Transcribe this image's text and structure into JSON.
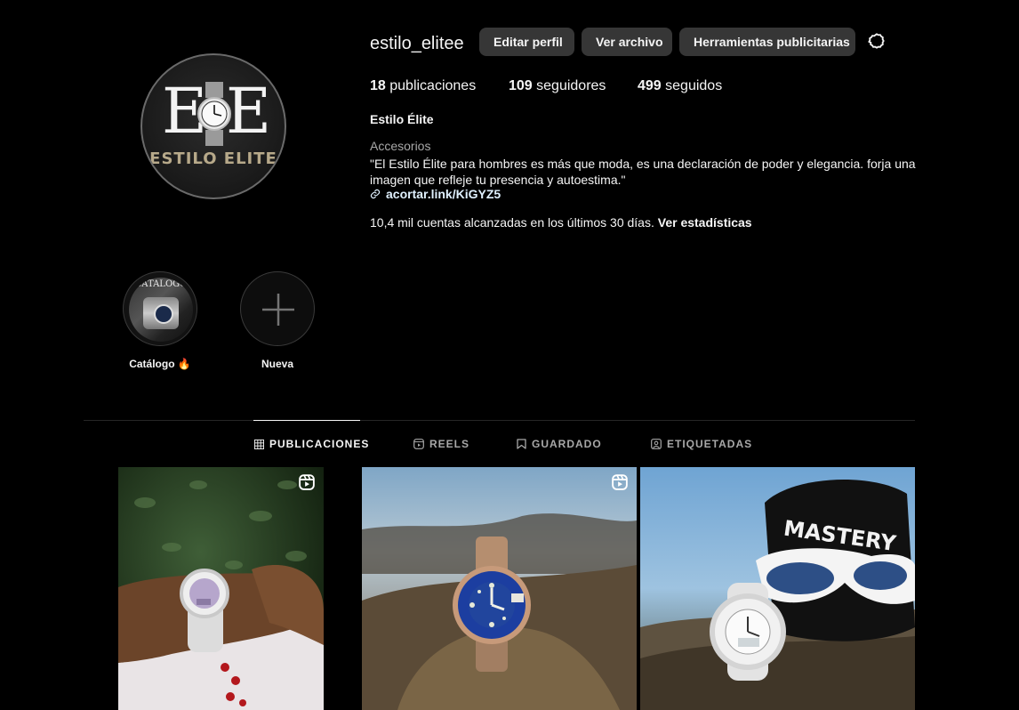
{
  "profile": {
    "username": "estilo_elitee",
    "avatar_logo_letters": [
      "E",
      "E"
    ],
    "avatar_logo_text": "ESTILO ELITE",
    "buttons": {
      "edit": "Editar perfil",
      "archive": "Ver archivo",
      "ad_tools": "Herramientas publicitarias"
    },
    "stats": [
      {
        "count": "18",
        "label": "publicaciones"
      },
      {
        "count": "109",
        "label": "seguidores"
      },
      {
        "count": "499",
        "label": "seguidos"
      }
    ],
    "full_name": "Estilo Élite",
    "category": "Accesorios",
    "bio": "\"El Estilo Élite para hombres es más que moda, es una declaración de poder y elegancia. forja una imagen que refleje tu presencia y autoestima.\"",
    "link": "acortar.link/KiGYZ5",
    "reach_text": "10,4 mil cuentas alcanzadas en los últimos 30 días.",
    "reach_link": "Ver estadísticas"
  },
  "highlights": [
    {
      "label": "Catálogo 🔥",
      "thumb_text": "CATALOGO"
    },
    {
      "label": "Nueva"
    }
  ],
  "tabs": [
    {
      "label": "PUBLICACIONES",
      "active": true,
      "icon": "grid-icon"
    },
    {
      "label": "REELS",
      "active": false,
      "icon": "reels-icon"
    },
    {
      "label": "GUARDADO",
      "active": false,
      "icon": "bookmark-icon"
    },
    {
      "label": "ETIQUETADAS",
      "active": false,
      "icon": "tagged-icon"
    }
  ],
  "posts": [
    {
      "subject": "white G-Shock on wrist",
      "is_reel": true
    },
    {
      "subject": "gold Rolex Submariner on rock",
      "is_reel": true
    },
    {
      "subject": "white G-Shock with cap and sunglasses",
      "is_reel": false,
      "cap_text": "MASTERY"
    }
  ],
  "colors": {
    "background": "#000000",
    "button": "#363636",
    "text_secondary": "#a8a8a8",
    "link": "#e0f1ff"
  }
}
